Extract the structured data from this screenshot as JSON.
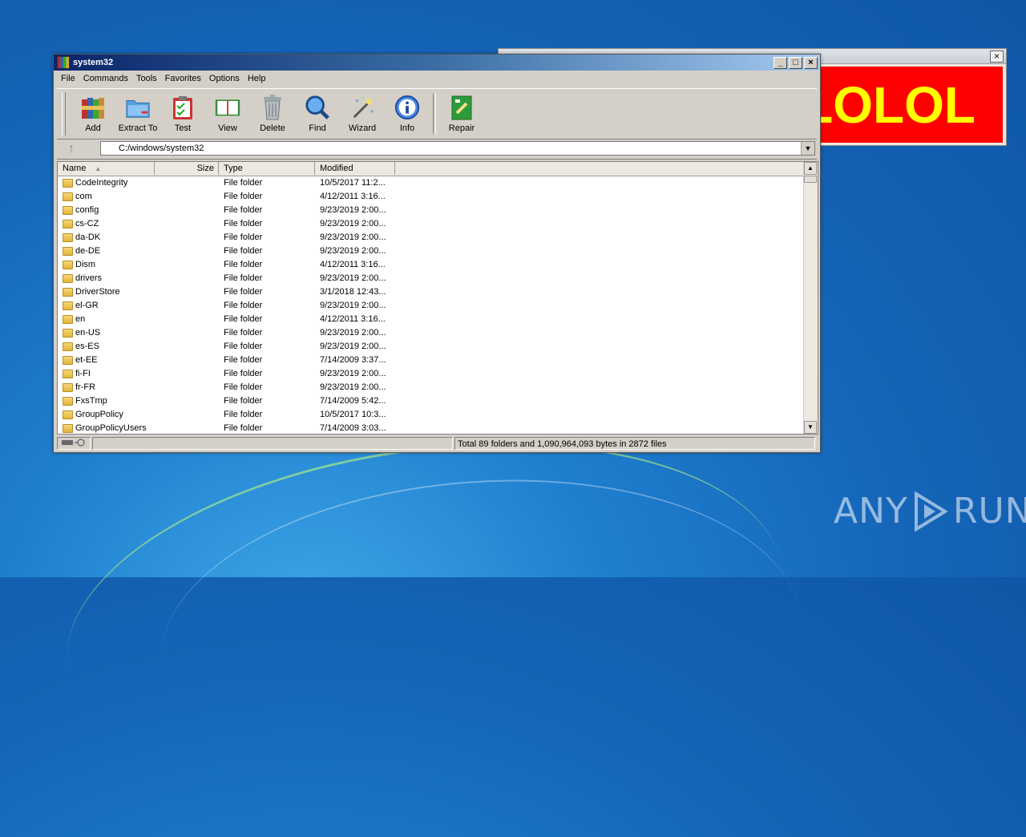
{
  "popup": {
    "text": "LOLOL",
    "close": "×"
  },
  "watermark": {
    "left": "ANY",
    "right": "RUN"
  },
  "window": {
    "title": "system32",
    "buttons": {
      "minimize": "_",
      "maximize": "□",
      "close": "×"
    }
  },
  "menu": [
    "File",
    "Commands",
    "Tools",
    "Favorites",
    "Options",
    "Help"
  ],
  "toolbar": [
    {
      "label": "Add",
      "icon": "archive-books-icon"
    },
    {
      "label": "Extract To",
      "icon": "folder-extract-icon"
    },
    {
      "label": "Test",
      "icon": "clipboard-check-icon"
    },
    {
      "label": "View",
      "icon": "open-book-icon"
    },
    {
      "label": "Delete",
      "icon": "trash-can-icon"
    },
    {
      "label": "Find",
      "icon": "magnifier-icon"
    },
    {
      "label": "Wizard",
      "icon": "magic-wand-icon"
    },
    {
      "label": "Info",
      "icon": "info-icon"
    },
    {
      "label": "Repair",
      "icon": "first-aid-box-icon"
    }
  ],
  "address": {
    "path": "C:/windows/system32",
    "up": "↑"
  },
  "columns": {
    "name": "Name",
    "size": "Size",
    "type": "Type",
    "modified": "Modified"
  },
  "files": [
    {
      "name": "CodeIntegrity",
      "type": "File folder",
      "modified": "10/5/2017 11:2..."
    },
    {
      "name": "com",
      "type": "File folder",
      "modified": "4/12/2011 3:16..."
    },
    {
      "name": "config",
      "type": "File folder",
      "modified": "9/23/2019 2:00..."
    },
    {
      "name": "cs-CZ",
      "type": "File folder",
      "modified": "9/23/2019 2:00..."
    },
    {
      "name": "da-DK",
      "type": "File folder",
      "modified": "9/23/2019 2:00..."
    },
    {
      "name": "de-DE",
      "type": "File folder",
      "modified": "9/23/2019 2:00..."
    },
    {
      "name": "Dism",
      "type": "File folder",
      "modified": "4/12/2011 3:16..."
    },
    {
      "name": "drivers",
      "type": "File folder",
      "modified": "9/23/2019 2:00..."
    },
    {
      "name": "DriverStore",
      "type": "File folder",
      "modified": "3/1/2018 12:43..."
    },
    {
      "name": "el-GR",
      "type": "File folder",
      "modified": "9/23/2019 2:00..."
    },
    {
      "name": "en",
      "type": "File folder",
      "modified": "4/12/2011 3:16..."
    },
    {
      "name": "en-US",
      "type": "File folder",
      "modified": "9/23/2019 2:00..."
    },
    {
      "name": "es-ES",
      "type": "File folder",
      "modified": "9/23/2019 2:00..."
    },
    {
      "name": "et-EE",
      "type": "File folder",
      "modified": "7/14/2009 3:37..."
    },
    {
      "name": "fi-FI",
      "type": "File folder",
      "modified": "9/23/2019 2:00..."
    },
    {
      "name": "fr-FR",
      "type": "File folder",
      "modified": "9/23/2019 2:00..."
    },
    {
      "name": "FxsTmp",
      "type": "File folder",
      "modified": "7/14/2009 5:42..."
    },
    {
      "name": "GroupPolicy",
      "type": "File folder",
      "modified": "10/5/2017 10:3..."
    },
    {
      "name": "GroupPolicyUsers",
      "type": "File folder",
      "modified": "7/14/2009 3:03..."
    }
  ],
  "status": {
    "summary": "Total 89 folders and 1,090,964,093 bytes in 2872 files"
  }
}
